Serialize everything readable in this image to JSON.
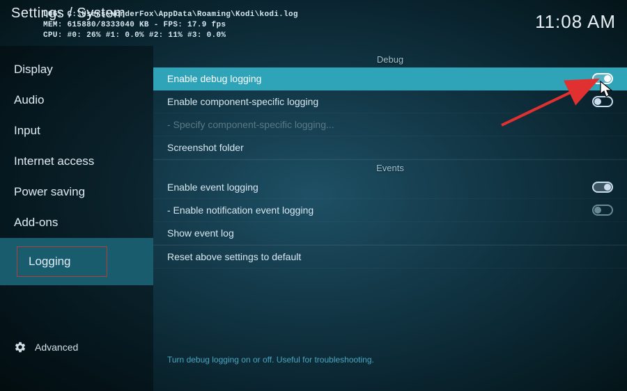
{
  "header": {
    "title": "Settings / System",
    "clock": "11:08 AM"
  },
  "debug_overlay": {
    "line1": "LOG: C:\\Users\\WonderFox\\AppData\\Roaming\\Kodi\\kodi.log",
    "line2": "MEM: 615880/8333040 KB - FPS: 17.9 fps",
    "line3": "CPU: #0:  26% #1: 0.0% #2:  11% #3: 0.0%"
  },
  "sidebar": {
    "items": [
      {
        "label": "Display"
      },
      {
        "label": "Audio"
      },
      {
        "label": "Input"
      },
      {
        "label": "Internet access"
      },
      {
        "label": "Power saving"
      },
      {
        "label": "Add-ons"
      },
      {
        "label": "Logging"
      }
    ],
    "footer_label": "Advanced"
  },
  "content": {
    "sections": {
      "debug": {
        "title": "Debug",
        "rows": {
          "enable_debug": "Enable debug logging",
          "enable_component": "Enable component-specific logging",
          "specify_component": "- Specify component-specific logging...",
          "screenshot_folder": "Screenshot folder"
        }
      },
      "events": {
        "title": "Events",
        "rows": {
          "enable_event": "Enable event logging",
          "enable_notification": "- Enable notification event logging",
          "show_event_log": "Show event log"
        }
      },
      "reset": "Reset above settings to default"
    },
    "hint": "Turn debug logging on or off. Useful for troubleshooting."
  }
}
